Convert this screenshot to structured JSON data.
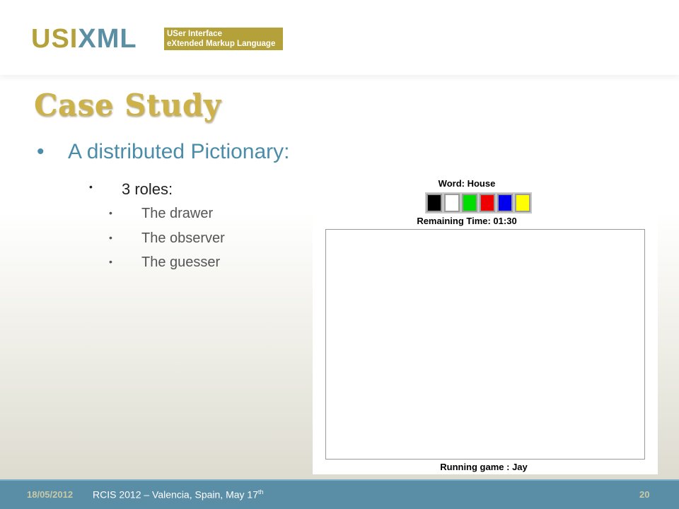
{
  "logo": {
    "usi": "USI",
    "xml": "XML",
    "tag_line1": "USer Interface",
    "tag_line2": "eXtended Markup Language"
  },
  "title": "Case Study",
  "bullet": {
    "marker": "•",
    "text": "A distributed Pictionary:",
    "sub": {
      "marker": "•",
      "text": "3 roles:",
      "items": [
        {
          "marker": "•",
          "text": "The drawer"
        },
        {
          "marker": "•",
          "text": "The observer"
        },
        {
          "marker": "•",
          "text": "The guesser"
        }
      ]
    }
  },
  "game": {
    "word": "Word: House",
    "palette": [
      "#000000",
      "#ffffff",
      "#00dd00",
      "#ee0000",
      "#0000ee",
      "#ffff00"
    ],
    "remaining_time": "Remaining Time:  01:30",
    "running": "Running game : Jay"
  },
  "footer": {
    "date": "18/05/2012",
    "conference": "RCIS 2012 – Valencia, Spain, May 17",
    "conference_sup": "th",
    "page": "20"
  },
  "colors": {
    "gold": "#b5a139",
    "title": "#cdb24a",
    "blue": "#4b8ca8",
    "footer": "#5a8ea6"
  }
}
